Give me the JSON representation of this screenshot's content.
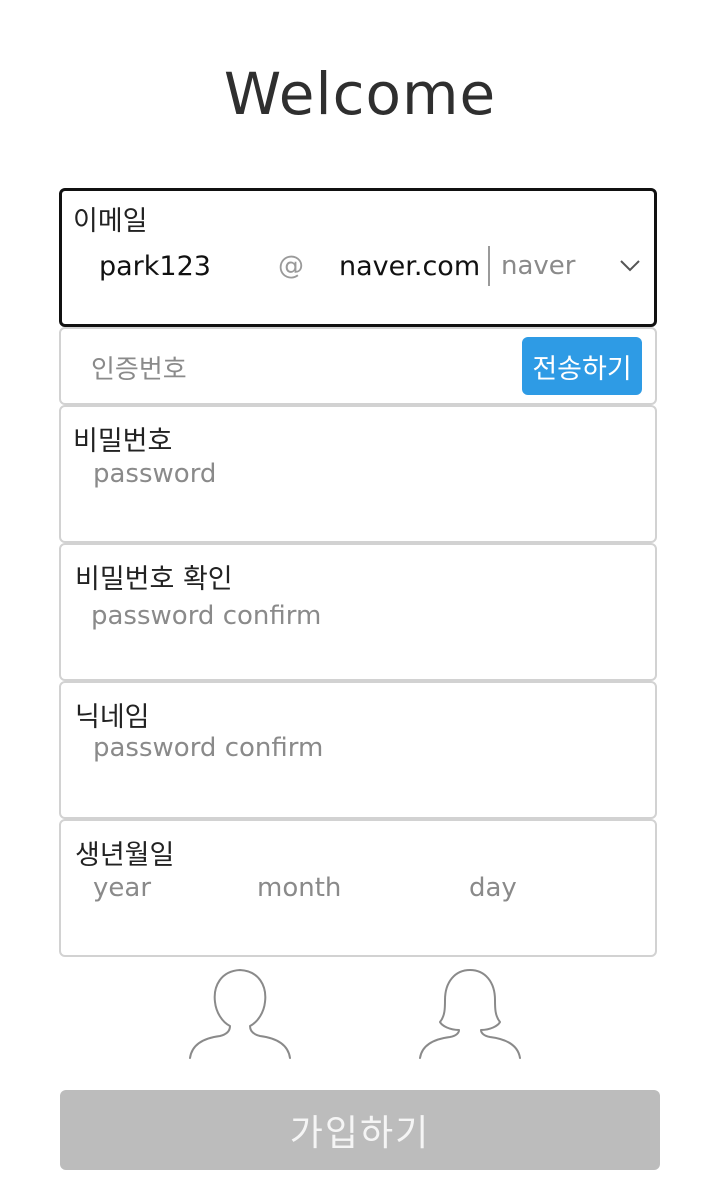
{
  "title": "Welcome",
  "email": {
    "label": "이메일",
    "id_value": "park123",
    "at_symbol": "@",
    "domain_value": "naver.com",
    "domain_select": "naver"
  },
  "verification": {
    "placeholder": "인증번호",
    "send_label": "전송하기"
  },
  "password": {
    "label": "비밀번호",
    "placeholder": "password"
  },
  "password_confirm": {
    "label": "비밀번호 확인",
    "placeholder": "password confirm"
  },
  "nickname": {
    "label": "닉네임",
    "placeholder": "password confirm"
  },
  "birth": {
    "label": "생년월일",
    "year_placeholder": "year",
    "month_placeholder": "month",
    "day_placeholder": "day"
  },
  "gender": {
    "icons": [
      "male-user-icon",
      "female-user-icon"
    ]
  },
  "signup_label": "가입하기",
  "colors": {
    "accent": "#2e9be5",
    "disabled_button": "#bcbcbc",
    "border": "#d2d2d2",
    "active_border": "#111111"
  }
}
